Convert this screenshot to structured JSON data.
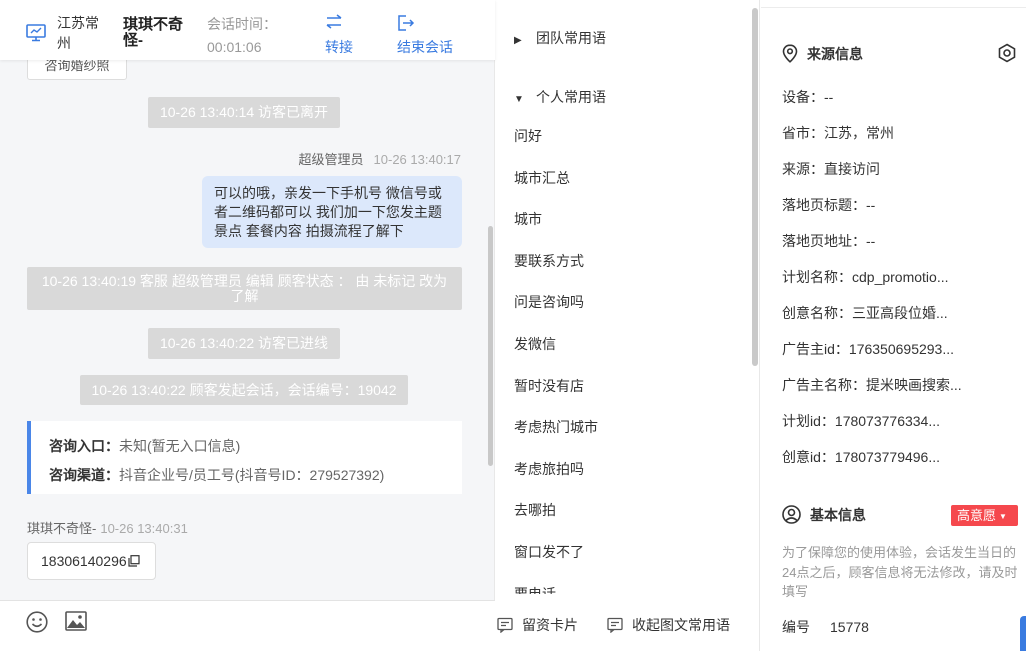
{
  "header": {
    "location": "江苏常州",
    "visitor_name": "琪琪不奇怪-",
    "session_label": "会话时间：",
    "session_time": "00:01:06",
    "transfer_label": "转接",
    "end_label": "结束会话"
  },
  "messages": {
    "prev_chip": "咨询婚纱照",
    "note_left": "10-26 13:40:14 访客已离开",
    "agent_name": "超级管理员",
    "agent_time": "10-26 13:40:17",
    "agent_text": "可以的哦，亲发一下手机号 微信号或者二维码都可以 我们加一下您发主题景点 套餐内容 拍摄流程了解下",
    "note_status": "10-26 13:40:19 客服 超级管理员 编辑 顾客状态 ： 由 未标记 改为 了解",
    "note_online": "10-26 13:40:22 访客已进线",
    "note_session": "10-26 13:40:22 顾客发起会话，会话编号：19042",
    "consult_entry_label": "咨询入口：",
    "consult_entry_value": "未知(暂无入口信息)",
    "consult_channel_label": "咨询渠道：",
    "consult_channel_value": "抖音企业号/员工号(抖音号ID：279527392)",
    "visitor_name": "琪琪不奇怪-",
    "visitor_time": "10-26 13:40:31",
    "phone": "18306140296"
  },
  "phrases": {
    "team_group": "团队常用语",
    "personal_group": "个人常用语",
    "items": [
      "问好",
      "城市汇总",
      "城市",
      "要联系方式",
      "问是咨询吗",
      "发微信",
      "暂时没有店",
      "考虑热门城市",
      "考虑旅拍吗",
      "去哪拍",
      "窗口发不了",
      "要电话"
    ],
    "card_btn": "留资卡片",
    "collapse_btn": "收起图文常用语"
  },
  "info": {
    "source_title": "来源信息",
    "rows": [
      {
        "label": "设备：",
        "value": "--"
      },
      {
        "label": "省市：",
        "value": "江苏，常州"
      },
      {
        "label": "来源：",
        "value": "直接访问"
      },
      {
        "label": "落地页标题：",
        "value": "--"
      },
      {
        "label": "落地页地址：",
        "value": "--"
      },
      {
        "label": "计划名称：",
        "value": "cdp_promotio..."
      },
      {
        "label": "创意名称：",
        "value": "三亚高段位婚..."
      },
      {
        "label": "广告主id：",
        "value": "176350695293..."
      },
      {
        "label": "广告主名称：",
        "value": "提米映画搜索..."
      },
      {
        "label": "计划id：",
        "value": "178073776334..."
      },
      {
        "label": "创意id：",
        "value": "178073779496..."
      }
    ],
    "basic_title": "基本信息",
    "intent_badge": "高意愿",
    "notice": "为了保障您的使用体验，会话发生当日的24点之后，顾客信息将无法修改，请及时填写",
    "id_label": "编号",
    "id_value": "15778"
  },
  "colors": {
    "accent": "#3a7be0",
    "agent_bubble": "#dce8fb",
    "system_note": "#d9d9d9",
    "badge_red": "#f5484d"
  },
  "icons": [
    "monitor-icon",
    "transfer-icon",
    "exit-icon",
    "copy-icon",
    "emoji-icon",
    "image-icon",
    "message-card-icon",
    "location-pin-icon",
    "eye-icon",
    "user-circle-icon"
  ]
}
